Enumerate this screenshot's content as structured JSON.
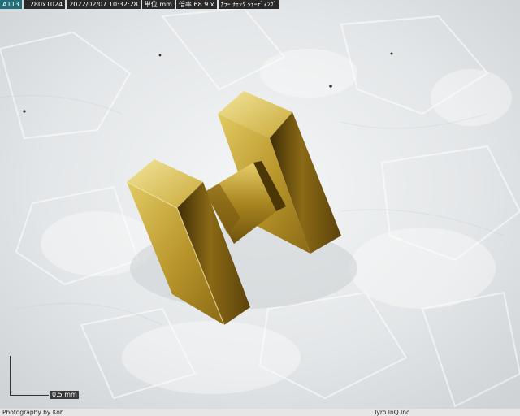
{
  "info_bar": {
    "id_badge": "A113",
    "resolution": "1280x1024",
    "timestamp": "2022/02/07 10:32:28",
    "unit": "単位 mm",
    "magnification": "倍率 68.9 x",
    "mode": "ｶﾗｰ ﾁｪｯｸ ｼｪｰﾃﾞｨﾝｸﾞ"
  },
  "scale_bar": {
    "label": "0.5 mm"
  },
  "footer": {
    "photo_credit": "Photography by Koh",
    "company": "Tyro InQ Inc"
  }
}
